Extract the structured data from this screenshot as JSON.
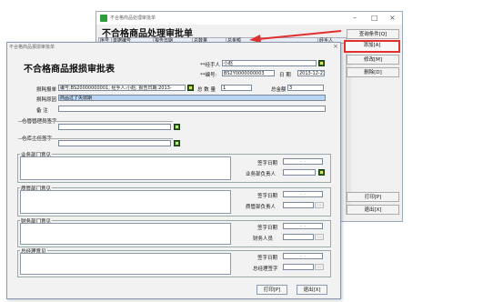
{
  "bg_window": {
    "title": "不合格商品处理审批单",
    "heading": "不合格商品处理审批单",
    "columns": [
      "序号",
      "单据编号",
      "报告日期",
      "总数量",
      "总金额",
      "经手人"
    ],
    "buttons": {
      "query": "查询条件[Q]",
      "add": "添加[A]",
      "edit": "修改[M]",
      "delete": "删除[D]",
      "print": "打印[P]",
      "exit": "退出[X]"
    }
  },
  "dialog": {
    "title": "不合格商品报损审批单",
    "heading": "不合格商品报损审批表",
    "handler_label": "**经手人",
    "handler_value": "小赵",
    "number_label": "**编号:",
    "number_value": "BS2Y0000000003",
    "date_label": "日 期",
    "date_value": "2013-12-23",
    "report_label": "损耗报单",
    "report_value": "编号:BS20000000001; 经手人:小赵; 报告日期:2013-",
    "qty_label": "总 数 量",
    "qty_value": "1",
    "amount_label": "总金额",
    "amount_value": "3",
    "reason_label": "损耗原因",
    "reason_value": "商品过了失效期",
    "remark_label": "备 注",
    "warehouse_label": "仓管管理员签字",
    "finance_head_label": "仓库主任签字",
    "sections": {
      "business": {
        "title": "业务部门意见",
        "sign_date": "签字日期",
        "person": "业务部负责人"
      },
      "quality": {
        "title": "质管部门意见",
        "sign_date": "签字日期",
        "person": "质管部负责人"
      },
      "finance": {
        "title": "财务部门意见",
        "sign_date": "签字日期",
        "person": "财务人员"
      },
      "manager": {
        "title": "总经理意见",
        "sign_date": "签字日期",
        "person": "总经理签字"
      }
    },
    "date_placeholder": "_-_-_",
    "icon_btn": "...",
    "print_btn": "打印[P]",
    "exit_btn": "退出[X]"
  },
  "colors": {
    "highlight": "#e03030",
    "accent_green": "#2b6b24",
    "selected_field": "#b9d4f2"
  }
}
